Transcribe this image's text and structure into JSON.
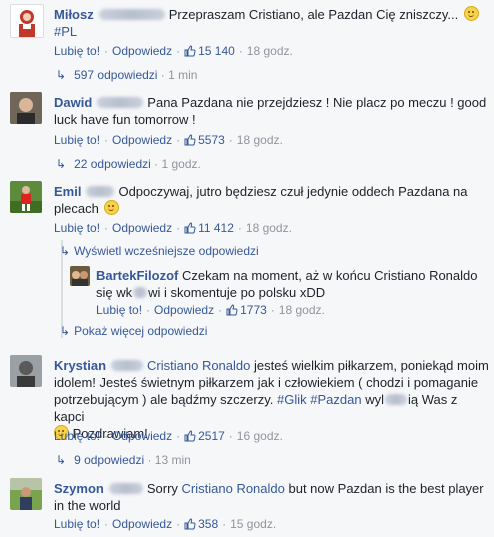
{
  "actions": {
    "like": "Lubię to!",
    "reply": "Odpowiedz"
  },
  "comments": [
    {
      "author": "Miłosz",
      "text": "Przepraszam Cristiano, ale Pazdan Cię zniszczy...",
      "hashtag": "#PL",
      "likes": "15 140",
      "time": "18 godz.",
      "replies_label": "597 odpowiedzi",
      "replies_time": "1 min"
    },
    {
      "author": "Dawid",
      "text": "Pana Pazdana nie przejdziesz ! Nie placz po meczu ! good luck have fun tomorrow !",
      "likes": "5573",
      "time": "18 godz.",
      "replies_label": "22 odpowiedzi",
      "replies_time": "1 godz."
    },
    {
      "author": "Emil",
      "text": "Odpoczywaj, jutro będziesz czuł jedynie oddech Pazdana na plecach",
      "likes": "11 412",
      "time": "18 godz.",
      "show_earlier": "Wyświetl wcześniejsze odpowiedzi",
      "reply": {
        "author": "BartekFilozof",
        "text_part1": "Czekam na moment, aż w końcu Cristiano Ronaldo się wk",
        "text_part2": "wi i skomentuje po polsku xDD",
        "likes": "1773",
        "time": "18 godz."
      },
      "show_more": "Pokaż więcej odpowiedzi"
    },
    {
      "author": "Krystian",
      "mention": "Cristiano Ronaldo",
      "text_part1": "jesteś wielkim piłkarzem, poniekąd moim idolem! Jesteś świetnym piłkarzem jak i człowiekiem ( chodzi i pomaganie potrzebującym ) ale bądźmy szczerzy.",
      "hashtag1": "#Glik",
      "hashtag2": "#Pazdan",
      "text_part2": "wyl",
      "text_part3": "ią Was z kapci",
      "text_part4": "Pozdrawiam!",
      "likes": "2517",
      "time": "16 godz.",
      "replies_label": "9 odpowiedzi",
      "replies_time": "13 min"
    },
    {
      "author": "Szymon",
      "text_part1": "Sorry",
      "mention": "Cristiano Ronaldo",
      "text_part2": "but now Pazdan is the best player in the world",
      "likes": "358",
      "time": "15 godz."
    }
  ]
}
